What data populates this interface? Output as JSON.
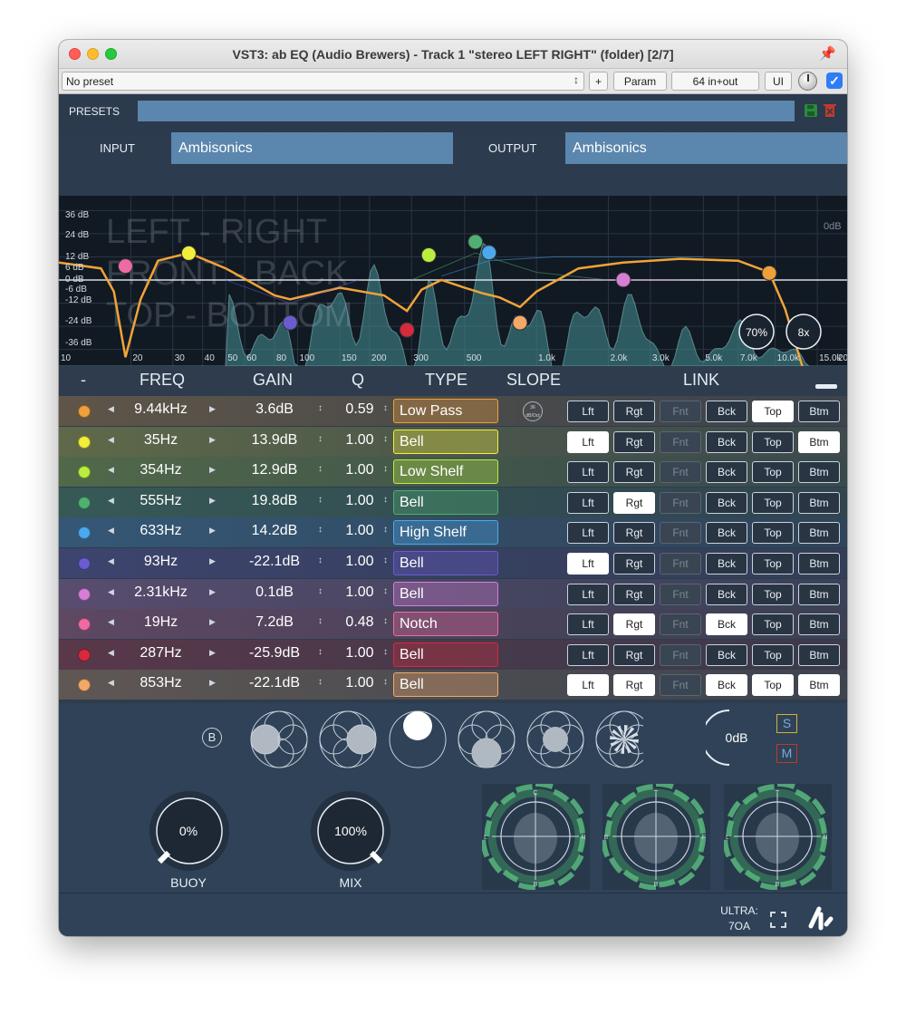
{
  "window": {
    "title": "VST3: ab EQ (Audio Brewers) - Track 1 \"stereo LEFT RIGHT\" (folder) [2/7]"
  },
  "toolbar": {
    "preset": "No preset",
    "plus": "+",
    "param": "Param",
    "io": "64 in+out",
    "ui": "UI"
  },
  "plugin": {
    "presets_label": "PRESETS",
    "input_label": "INPUT",
    "input_value": "Ambisonics",
    "output_label": "OUTPUT",
    "output_value": "Ambisonics",
    "graph": {
      "y_ticks": [
        "36 dB",
        "24 dB",
        "12 dB",
        "6 dB",
        "0 dB",
        "-6 dB",
        "-12 dB",
        "-24 dB",
        "-36 dB"
      ],
      "x_ticks": [
        "10",
        "20",
        "30",
        "40",
        "50",
        "60",
        "80",
        "100",
        "150",
        "200",
        "300",
        "500",
        "1.0k",
        "2.0k",
        "3.0k",
        "5.0k",
        "7.0k",
        "10.0k",
        "15.0k",
        "20"
      ],
      "overlay_lines": [
        "LEFT - RIGHT",
        "FRONT - BACK",
        "TOP - BOTTOM"
      ],
      "zero_db": "0dB",
      "knob_pct": "70%",
      "oversample": "8x"
    },
    "table": {
      "headers": {
        "dash": "-",
        "freq": "FREQ",
        "gain": "GAIN",
        "q": "Q",
        "type": "TYPE",
        "slope": "SLOPE",
        "link": "LINK"
      },
      "slope_badge": "36 dB/Oct",
      "link_labels": [
        "Lft",
        "Rgt",
        "Fnt",
        "Bck",
        "Top",
        "Btm"
      ],
      "rows": [
        {
          "color": "#f0a03a",
          "freq": "9.44kHz",
          "gain": "3.6dB",
          "q": "0.59",
          "type": "Low Pass",
          "links": [
            0,
            0,
            2,
            0,
            1,
            0
          ]
        },
        {
          "color": "#f2ef3c",
          "freq": "35Hz",
          "gain": "13.9dB",
          "q": "1.00",
          "type": "Bell",
          "links": [
            1,
            0,
            2,
            0,
            0,
            1
          ]
        },
        {
          "color": "#b9ee3e",
          "freq": "354Hz",
          "gain": "12.9dB",
          "q": "1.00",
          "type": "Low Shelf",
          "links": [
            0,
            0,
            2,
            0,
            0,
            0
          ]
        },
        {
          "color": "#4fb071",
          "freq": "555Hz",
          "gain": "19.8dB",
          "q": "1.00",
          "type": "Bell",
          "links": [
            0,
            1,
            2,
            0,
            0,
            0
          ]
        },
        {
          "color": "#4aa9ee",
          "freq": "633Hz",
          "gain": "14.2dB",
          "q": "1.00",
          "type": "High Shelf",
          "links": [
            0,
            0,
            2,
            0,
            0,
            0
          ]
        },
        {
          "color": "#6a5bd0",
          "freq": "93Hz",
          "gain": "-22.1dB",
          "q": "1.00",
          "type": "Bell",
          "links": [
            1,
            0,
            2,
            0,
            0,
            0
          ]
        },
        {
          "color": "#d67ed6",
          "freq": "2.31kHz",
          "gain": "0.1dB",
          "q": "1.00",
          "type": "Bell",
          "links": [
            0,
            0,
            2,
            0,
            0,
            0
          ]
        },
        {
          "color": "#ee6aa2",
          "freq": "19Hz",
          "gain": "7.2dB",
          "q": "0.48",
          "type": "Notch",
          "links": [
            0,
            1,
            2,
            1,
            0,
            0
          ]
        },
        {
          "color": "#d62a3e",
          "freq": "287Hz",
          "gain": "-25.9dB",
          "q": "1.00",
          "type": "Bell",
          "links": [
            0,
            0,
            2,
            0,
            0,
            0
          ]
        },
        {
          "color": "#f2a868",
          "freq": "853Hz",
          "gain": "-22.1dB",
          "q": "1.00",
          "type": "Bell",
          "links": [
            1,
            1,
            2,
            1,
            1,
            1
          ]
        }
      ]
    },
    "bottom": {
      "b_label": "B",
      "gain": "0dB",
      "solo": "S",
      "mute": "M",
      "buoy_val": "0%",
      "buoy_label": "BUOY",
      "mix_val": "100%",
      "mix_label": "MIX",
      "ultra_line1": "ULTRA:",
      "ultra_line2": "7OA"
    }
  }
}
